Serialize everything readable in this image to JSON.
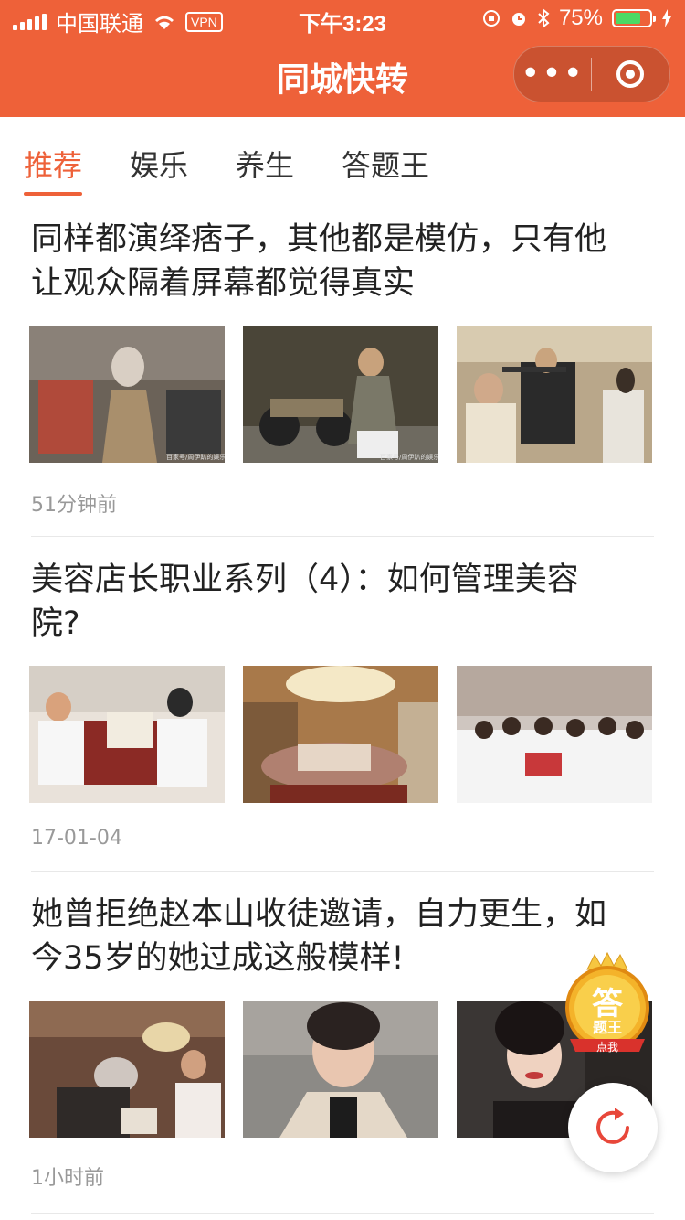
{
  "status": {
    "carrier": "中国联通",
    "vpn": "VPN",
    "time": "下午3:23",
    "battery_pct": "75%",
    "battery_level": 0.75
  },
  "header": {
    "title": "同城快转",
    "menu_icon": "more-dots-icon",
    "close_icon": "target-circle-icon"
  },
  "tabs": [
    {
      "label": "推荐",
      "active": true
    },
    {
      "label": "娱乐",
      "active": false
    },
    {
      "label": "养生",
      "active": false
    },
    {
      "label": "答题王",
      "active": false
    }
  ],
  "articles": [
    {
      "title_line1": "同样都演绎痞子，其他都是模仿，只有他",
      "title_line2": "让观众隔着屏幕都觉得真实",
      "time": "51分钟前",
      "image_watermark": "百家号/周伊趴的娱乐"
    },
    {
      "title_line1": "美容店长职业系列（4）：如何管理美容",
      "title_line2": "院?",
      "time": "17-01-04"
    },
    {
      "title_line1": "她曾拒绝赵本山收徒邀请，自力更生，如",
      "title_line2": "今35岁的她过成这般模样!",
      "time": "1小时前"
    }
  ],
  "floating": {
    "badge_text": "答",
    "badge_sub": "题王",
    "badge_cta": "点我",
    "refresh_icon": "refresh-icon"
  },
  "colors": {
    "brand": "#ee6139",
    "text": "#222222",
    "meta": "#999999"
  }
}
